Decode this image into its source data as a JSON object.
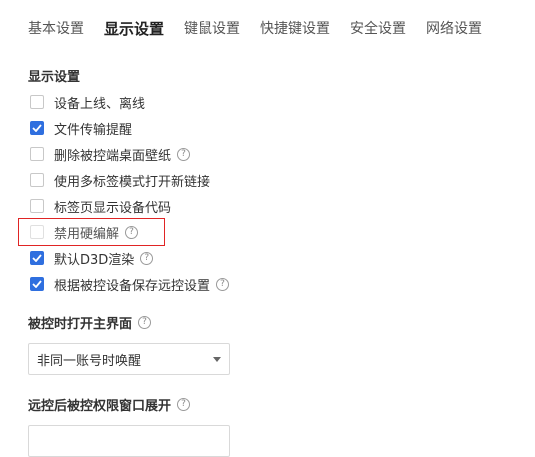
{
  "tabs": [
    {
      "label": "基本设置",
      "active": false
    },
    {
      "label": "显示设置",
      "active": true
    },
    {
      "label": "键鼠设置",
      "active": false
    },
    {
      "label": "快捷键设置",
      "active": false
    },
    {
      "label": "安全设置",
      "active": false
    },
    {
      "label": "网络设置",
      "active": false
    }
  ],
  "display_section": {
    "title": "显示设置",
    "options": [
      {
        "label": "设备上线、离线",
        "checked": false,
        "help": false
      },
      {
        "label": "文件传输提醒",
        "checked": true,
        "help": false
      },
      {
        "label": "删除被控端桌面壁纸",
        "checked": false,
        "help": true
      },
      {
        "label": "使用多标签模式打开新链接",
        "checked": false,
        "help": false
      },
      {
        "label": "标签页显示设备代码",
        "checked": false,
        "help": false
      },
      {
        "label": "禁用硬编解",
        "checked": false,
        "help": true
      },
      {
        "label": "默认D3D渲染",
        "checked": true,
        "help": true
      },
      {
        "label": "根据被控设备保存远控设置",
        "checked": true,
        "help": true
      }
    ]
  },
  "open_main_ui": {
    "title": "被控时打开主界面",
    "select_value": "非同一账号时唤醒"
  },
  "expand_window": {
    "title": "远控后被控权限窗口展开",
    "select_value": ""
  },
  "colors": {
    "accent": "#2f6fdf",
    "highlight_border": "#e02424"
  },
  "icons": {
    "help": "?"
  }
}
